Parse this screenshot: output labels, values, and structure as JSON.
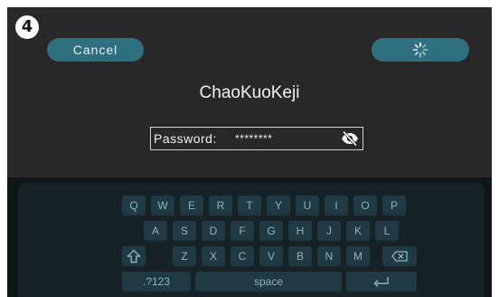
{
  "step": "4",
  "header": {
    "cancel_label": "Cancel",
    "confirm_icon": "loading-spinner-icon"
  },
  "network": {
    "ssid": "ChaoKuoKeji"
  },
  "password": {
    "label": "Password:",
    "value": "********",
    "toggle_icon": "eye-slash-icon"
  },
  "keyboard": {
    "row1": [
      "Q",
      "W",
      "E",
      "R",
      "T",
      "Y",
      "U",
      "I",
      "O",
      "P"
    ],
    "row2": [
      "A",
      "S",
      "D",
      "F",
      "G",
      "H",
      "J",
      "K",
      "L"
    ],
    "row3": [
      "Z",
      "X",
      "C",
      "V",
      "B",
      "N",
      "M"
    ],
    "shift_icon": "shift-arrow-icon",
    "backspace_icon": "backspace-icon",
    "numeric_label": ".?123",
    "space_label": "space",
    "enter_icon": "enter-arrow-icon"
  },
  "colors": {
    "screen_bg": "#2a2826",
    "button_bg": "#2e7080",
    "key_bg": "#1f3a42",
    "key_text": "#8fb3bd"
  }
}
